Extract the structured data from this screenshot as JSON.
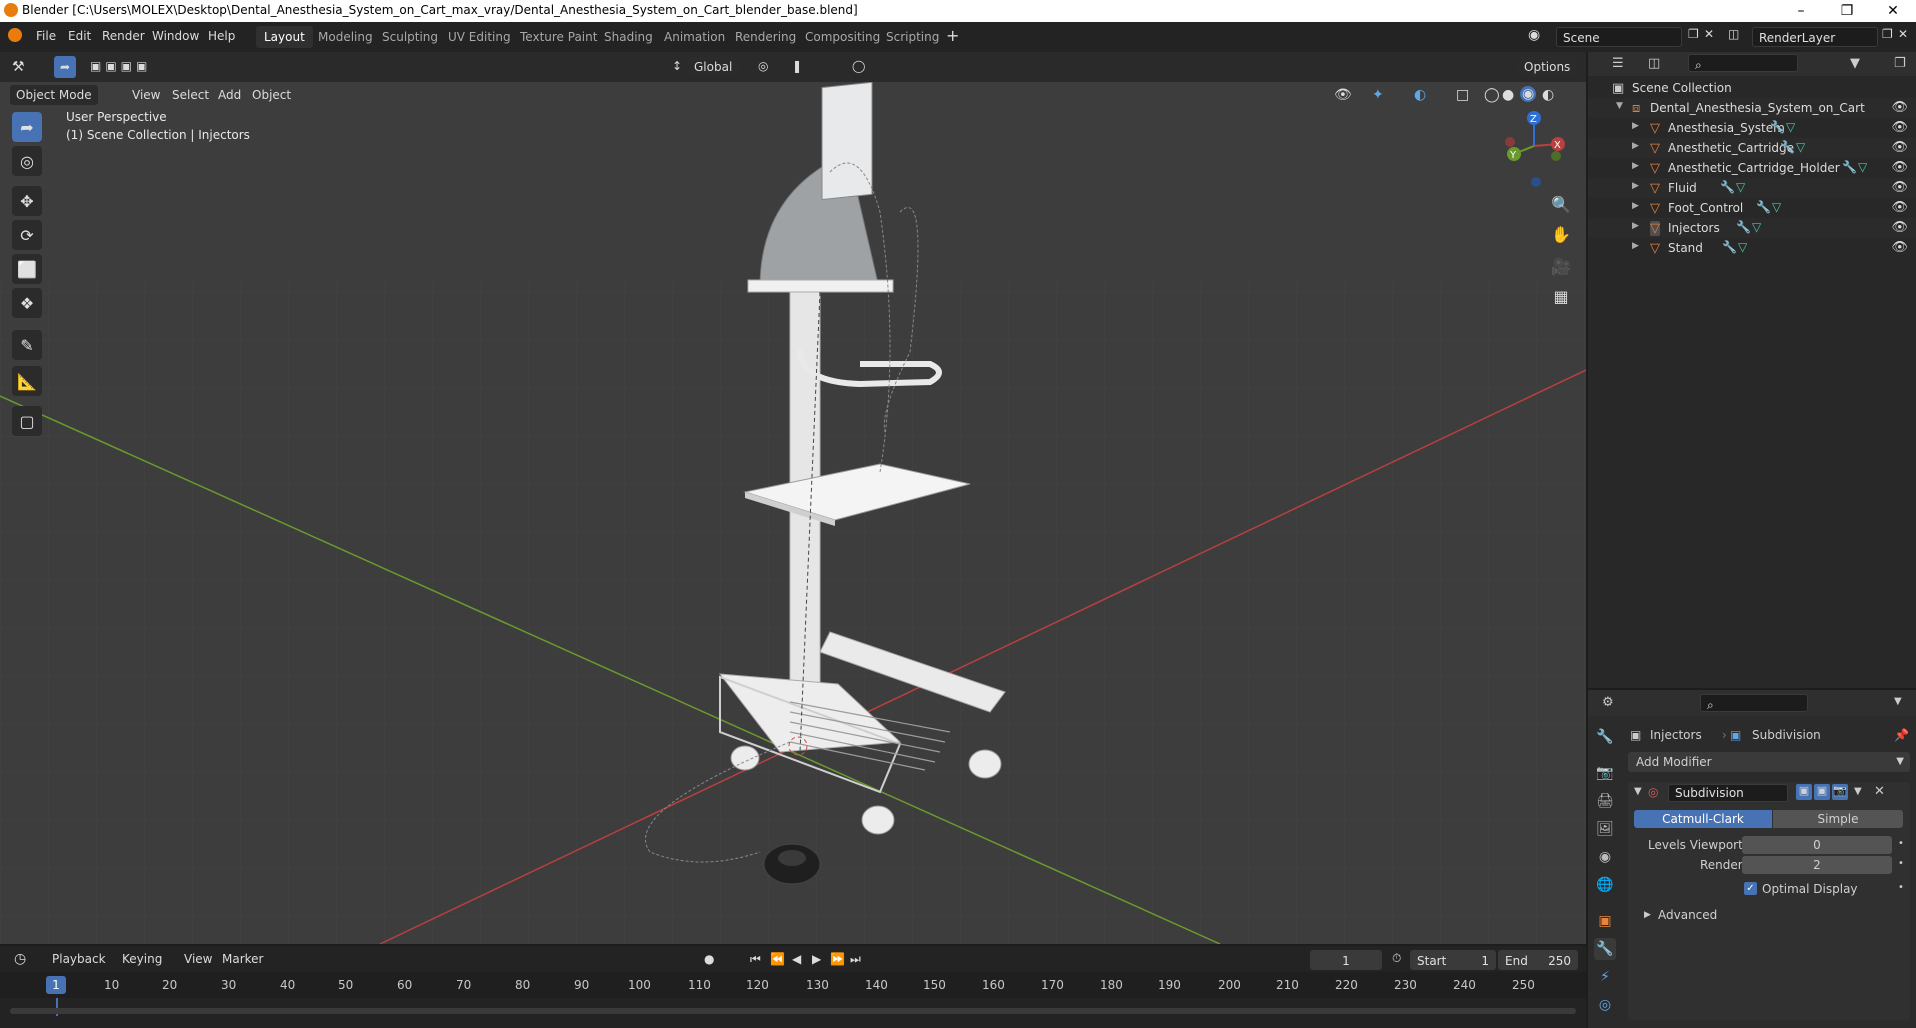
{
  "window": {
    "title": "Blender [C:\\Users\\MOLEX\\Desktop\\Dental_Anesthesia_System_on_Cart_max_vray/Dental_Anesthesia_System_on_Cart_blender_base.blend]"
  },
  "menu": [
    "File",
    "Edit",
    "Render",
    "Window",
    "Help"
  ],
  "workspaces": [
    "Layout",
    "Modeling",
    "Sculpting",
    "UV Editing",
    "Texture Paint",
    "Shading",
    "Animation",
    "Rendering",
    "Compositing",
    "Scripting"
  ],
  "scene": {
    "name": "Scene",
    "render_layer": "RenderLayer"
  },
  "toolbar": {
    "transform_orientation": "Global",
    "options": "Options"
  },
  "viewport": {
    "mode": "Object Mode",
    "menus": [
      "View",
      "Select",
      "Add",
      "Object"
    ],
    "overlay_line1": "User Perspective",
    "overlay_line2": "(1) Scene Collection | Injectors",
    "gizmo_axes": {
      "x": "X",
      "y": "Y",
      "z": "Z"
    }
  },
  "outliner": {
    "root": "Scene Collection",
    "collection": "Dental_Anesthesia_System_on_Cart",
    "objects": [
      "Anesthesia_System",
      "Anesthetic_Cartridge",
      "Anesthetic_Cartridge_Holder",
      "Fluid",
      "Foot_Control",
      "Injectors",
      "Stand"
    ]
  },
  "properties": {
    "breadcrumb_object": "Injectors",
    "breadcrumb_modifier": "Subdivision",
    "add_modifier": "Add Modifier",
    "modifier_name": "Subdivision",
    "algorithm_options": [
      "Catmull-Clark",
      "Simple"
    ],
    "algorithm_selected": "Catmull-Clark",
    "levels_viewport_label": "Levels Viewport",
    "levels_viewport": "0",
    "render_label": "Render",
    "render_levels": "2",
    "optimal_display_label": "Optimal Display",
    "optimal_display": true,
    "advanced_label": "Advanced"
  },
  "timeline": {
    "menus": [
      "Playback",
      "Keying",
      "View",
      "Marker"
    ],
    "current_frame": "1",
    "start_label": "Start",
    "start": "1",
    "end_label": "End",
    "end": "250",
    "ruler": [
      "1",
      "10",
      "20",
      "30",
      "40",
      "50",
      "60",
      "70",
      "80",
      "90",
      "100",
      "110",
      "120",
      "130",
      "140",
      "150",
      "160",
      "170",
      "180",
      "190",
      "200",
      "210",
      "220",
      "230",
      "240",
      "250"
    ]
  },
  "colors": {
    "accent": "#4772b3",
    "viewport_bg": "#3d3d3d",
    "x_axis": "#b8403f",
    "y_axis": "#6a9a2d",
    "z_axis": "#2f6fd4"
  }
}
